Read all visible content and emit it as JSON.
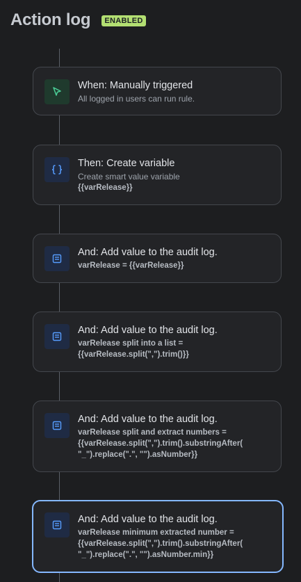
{
  "header": {
    "title": "Action log",
    "status_badge": "ENABLED"
  },
  "colors": {
    "background": "#1d1e20",
    "card_background": "#232427",
    "badge_green": "#b3df72",
    "selected_border": "#85b8ff",
    "trigger_icon": "#4bce97",
    "action_icon": "#579dff"
  },
  "steps": [
    {
      "icon": "cursor-arrow-icon",
      "heading": "When: Manually triggered",
      "description": "All logged in users can run rule.",
      "code": ""
    },
    {
      "icon": "curly-braces-icon",
      "heading": "Then: Create variable",
      "description": "Create smart value variable",
      "code": "{{varRelease}}"
    },
    {
      "icon": "audit-log-icon",
      "heading": "And: Add value to the audit log.",
      "description": "",
      "code": "varRelease = {{varRelease}}"
    },
    {
      "icon": "audit-log-icon",
      "heading": "And: Add value to the audit log.",
      "description": "",
      "code": "varRelease split into a list =\n{{varRelease.split(\",\").trim()}}"
    },
    {
      "icon": "audit-log-icon",
      "heading": "And: Add value to the audit log.",
      "description": "",
      "code": "varRelease split and extract numbers =\n{{varRelease.split(\",\").trim().substringAfter(\n\"_\").replace(\".\", \"\").asNumber}}"
    },
    {
      "icon": "audit-log-icon",
      "heading": "And: Add value to the audit log.",
      "description": "",
      "code": "varRelease minimum extracted number =\n{{varRelease.split(\",\").trim().substringAfter(\n\"_\").replace(\".\", \"\").asNumber.min}}"
    }
  ]
}
